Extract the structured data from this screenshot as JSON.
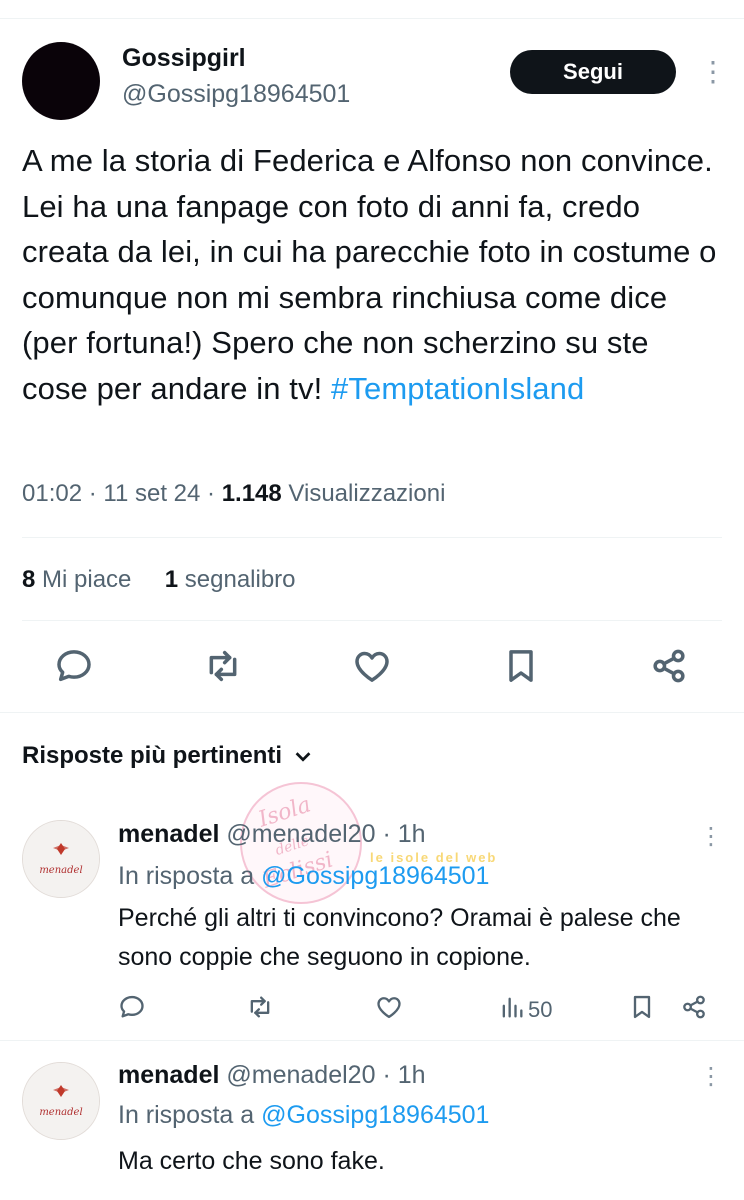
{
  "tweet": {
    "author_name": "Gossipgirl",
    "author_handle": "@Gossipg18964501",
    "follow_label": "Segui",
    "text": "A me la storia di Federica e Alfonso non convince. Lei ha una fanpage con foto di anni fa, credo creata da lei, in cui ha parecchie foto in costume o comunque non mi sembra rinchiusa come dice (per fortuna!) Spero che non scherzino su ste cose per andare in tv! ",
    "hashtag": "#TemptationIsland",
    "time": "01:02",
    "date": "11 set 24",
    "views_count": "1.148",
    "views_label": "Visualizzazioni",
    "likes_count": "8",
    "likes_label": "Mi piace",
    "bookmarks_count": "1",
    "bookmarks_label": "segnalibro"
  },
  "replies_header": {
    "label": "Risposte più pertinenti"
  },
  "replies": [
    {
      "name": "menadel",
      "handle": "@menadel20",
      "time": "1h",
      "in_reply_prefix": "In risposta a",
      "mention": "@Gossipg18964501",
      "text": "Perché gli altri ti convincono? Oramai è palese che sono coppie che seguono in copione.",
      "views": "50"
    },
    {
      "name": "menadel",
      "handle": "@menadel20",
      "time": "1h",
      "in_reply_prefix": "In risposta a",
      "mention": "@Gossipg18964501",
      "text": "Ma certo che sono fake."
    }
  ],
  "avatar_text": "menadel",
  "watermark": {
    "line1": "Isola",
    "line2": "delle",
    "line3": "Eclissi",
    "banner": "le isole del web"
  },
  "colors": {
    "link": "#1d9bf0",
    "secondary": "#536471",
    "primary": "#0f1419"
  }
}
